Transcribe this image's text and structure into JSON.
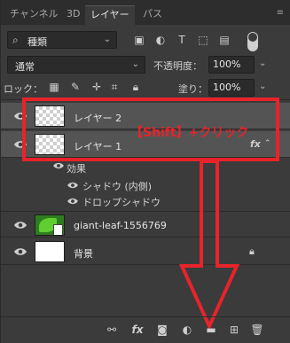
{
  "tabs": [
    {
      "label": "チャンネル"
    },
    {
      "label": "3D"
    },
    {
      "label": "レイヤー"
    },
    {
      "label": "パス"
    }
  ],
  "tabs_menu_icon": "panel-menu-icon",
  "filter": {
    "type_label": "種類",
    "icons": [
      "image-filter-icon",
      "adjustment-filter-icon",
      "type-filter-icon",
      "shape-filter-icon",
      "smartobject-filter-icon"
    ]
  },
  "blend": {
    "mode": "通常",
    "opacity_label": "不透明度：",
    "opacity": "100%"
  },
  "lock": {
    "label": "ロック：",
    "icons": [
      "lock-transparent-icon",
      "lock-image-icon",
      "lock-position-icon",
      "lock-artboard-icon",
      "lock-all-icon"
    ],
    "fill_label": "塗り：",
    "fill": "100%"
  },
  "layers": [
    {
      "name": "レイヤー 2",
      "selected": true
    },
    {
      "name": "レイヤー 1",
      "selected": true,
      "fx": "fx"
    },
    {
      "name": "giant-leaf-1556769",
      "selected": false
    },
    {
      "name": "背景",
      "selected": false
    }
  ],
  "effects": {
    "header": "効果",
    "items": [
      "シャドウ (内側)",
      "ドロップシャドウ"
    ]
  },
  "annotation": {
    "text": "【Shift】+クリック",
    "color": "#e8232a"
  },
  "bottom_icons": [
    "link-layers-icon",
    "fx-icon",
    "mask-icon",
    "adjustment-icon",
    "folder-icon",
    "new-layer-icon",
    "trash-icon"
  ],
  "colors": {
    "panel_bg": "#3b3b3b",
    "selected_bg": "#545454",
    "accent_red": "#e8232a"
  }
}
